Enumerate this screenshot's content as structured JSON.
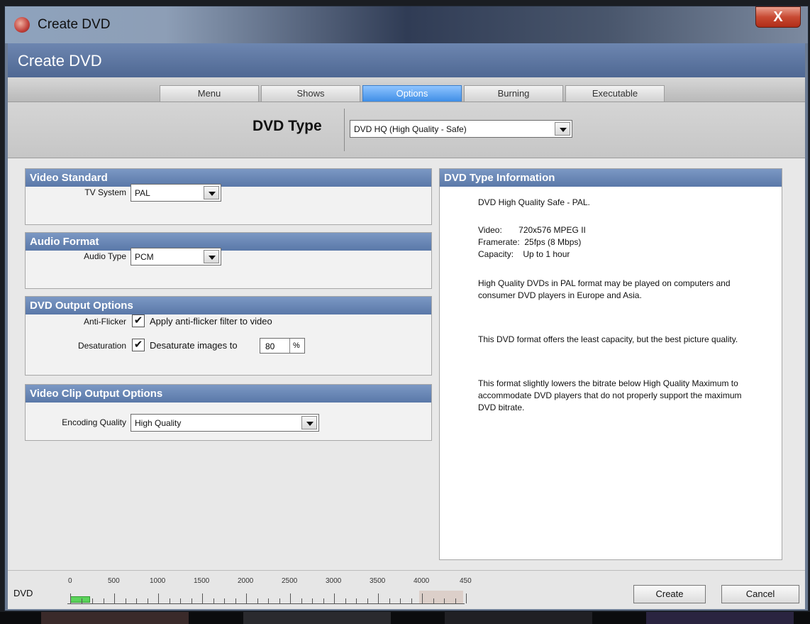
{
  "window": {
    "title": "Create DVD",
    "close_label": "X"
  },
  "header": {
    "title": "Create DVD"
  },
  "tabs": [
    {
      "label": "Menu",
      "active": false
    },
    {
      "label": "Shows",
      "active": false
    },
    {
      "label": "Options",
      "active": true
    },
    {
      "label": "Burning",
      "active": false
    },
    {
      "label": "Executable",
      "active": false
    }
  ],
  "dvd_type": {
    "label": "DVD Type",
    "value": "DVD HQ (High Quality - Safe)"
  },
  "video_standard": {
    "title": "Video Standard",
    "tv_system_label": "TV System",
    "tv_system_value": "PAL"
  },
  "audio_format": {
    "title": "Audio Format",
    "audio_type_label": "Audio Type",
    "audio_type_value": "PCM"
  },
  "dvd_output": {
    "title": "DVD Output Options",
    "anti_flicker_label": "Anti-Flicker",
    "anti_flicker_checked": true,
    "anti_flicker_text": "Apply anti-flicker filter to video",
    "desaturation_label": "Desaturation",
    "desaturation_checked": true,
    "desaturation_text": "Desaturate images to",
    "desaturation_value": "80",
    "desaturation_unit": "%",
    "check_mark": "✔"
  },
  "clip_output": {
    "title": "Video Clip Output Options",
    "encoding_label": "Encoding Quality",
    "encoding_value": "High Quality"
  },
  "info": {
    "title": "DVD Type Information",
    "line1": "DVD High Quality Safe - PAL.",
    "video": "Video:       720x576 MPEG II",
    "framerate": "Framerate:  25fps (8 Mbps)",
    "capacity": "Capacity:    Up to 1 hour",
    "para1": "High Quality DVDs in PAL format may be played on computers and consumer DVD players in Europe and Asia.",
    "para2": "This DVD format offers the least capacity, but the best picture quality.",
    "para3": "This format slightly lowers the bitrate below High Quality Maximum to accommodate DVD players that do not properly support the maximum DVD bitrate."
  },
  "capacity_bar": {
    "label": "DVD",
    "ticks": [
      "0",
      "500",
      "1000",
      "1500",
      "2000",
      "2500",
      "3000",
      "3500",
      "4000",
      "450"
    ],
    "used_fraction": 0.05
  },
  "buttons": {
    "create": "Create",
    "cancel": "Cancel"
  },
  "colors": {
    "accent": "#3f8ee6",
    "group_header": "#6a88b6",
    "used": "#5bd35b"
  }
}
